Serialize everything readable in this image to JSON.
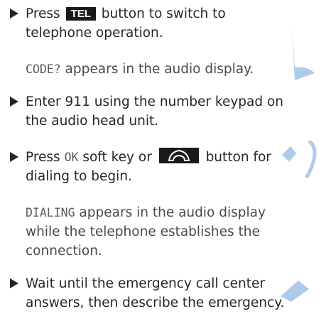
{
  "steps": [
    {
      "pre": "Press ",
      "key": "TEL",
      "post": " button to switch to",
      "line2": "telephone operation."
    },
    {
      "line1": "Enter 911 using the number keypad on",
      "line2": "the audio head unit."
    },
    {
      "pre": "Press ",
      "softkey": "OK",
      "mid": " soft key or ",
      "post": " button for",
      "line2": "dialing to begin.",
      "button_icon": "phone-handset-icon"
    },
    {
      "line1": "Wait until the emergency call center",
      "line2": "answers, then describe the emergency."
    }
  ],
  "notes": [
    {
      "code": "CODE?",
      "text": " appears in the audio display."
    },
    {
      "code": "DIALING",
      "text": " appears in the audio display",
      "line2": "while the telephone establishes the",
      "line3": "connection."
    }
  ],
  "colors": {
    "text": "#262626",
    "key_background": "#1a1a1a",
    "watermark": "#6f9fd8"
  }
}
